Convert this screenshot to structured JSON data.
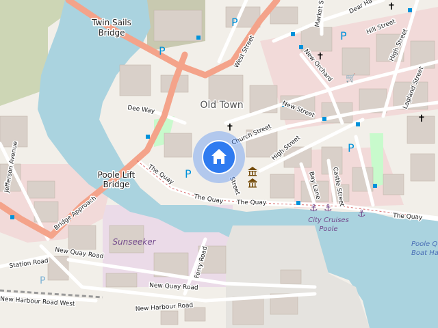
{
  "map": {
    "places": {
      "old_town": "Old Town",
      "twin_sails_bridge": [
        "Twin Sails",
        "Bridge"
      ],
      "poole_lift_bridge": [
        "Poole Lift",
        "Bridge"
      ],
      "sunseeker": "Sunseeker",
      "city_cruises": [
        "City Cruises",
        "Poole"
      ],
      "poole_quay_boat_haven": [
        "Poole Q",
        "Boat Ha"
      ]
    },
    "streets": {
      "west_street": "West Street",
      "dee_way": "Dee Way",
      "church_street": "Church Street",
      "new_street": "New Street",
      "high_street": "High Street",
      "the_quay_1": "The Quay",
      "the_quay_2": "The Quay",
      "the_quay_3": "The Quay",
      "the_quay_4": "The Quay",
      "bridge_approach": "Bridge Approach",
      "station_road": "Station Road",
      "new_quay_road": "New Quay Road",
      "new_quay_road_2": "New Quay Road",
      "new_harbour_road": "New Harbour Road",
      "new_harbour_road_west": "New Harbour Road West",
      "ferry_road": "Ferry Road",
      "jefferson_avenue": "Jefferson Avenue",
      "new_orchard": "New Orchard",
      "market_street": "Market Street",
      "dear_hay_lane": "Dear Ha",
      "hill_street": "Hill Street",
      "high_street_north": "High Street",
      "lagland_street": "Lagland Street",
      "bay_lane": "Bay Lane",
      "castle_street": "Castle Street",
      "strand_street": "Street"
    },
    "icons": {
      "home": "home-icon",
      "parking": "P",
      "church": "church-icon",
      "museum": "museum-icon",
      "anchor": "anchor-icon",
      "bus_stop": "bus-stop-icon",
      "shop": "shop-icon"
    },
    "colors": {
      "water": "#aad3df",
      "land": "#f2efe9",
      "primary_road": "#f4a38a",
      "residential": "#e0dfdf",
      "commercial": "#f2dad9",
      "industrial": "#ebdbe8",
      "park": "#c8facc",
      "building": "#d9d0c9",
      "location_marker": "#3b82f6"
    }
  }
}
